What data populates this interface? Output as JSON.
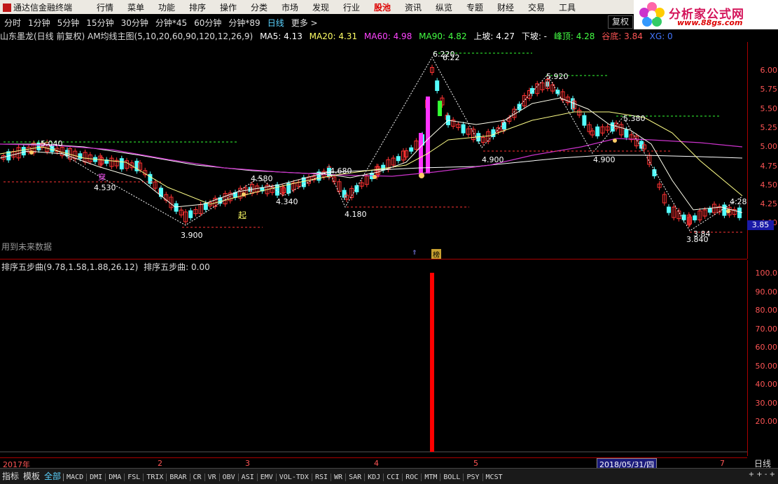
{
  "app": {
    "title": "通达信金融终端"
  },
  "menu": [
    "行情",
    "菜单",
    "功能",
    "排序",
    "操作",
    "分类",
    "市场",
    "发现",
    "行业",
    "股池",
    "资讯",
    "纵览",
    "专题",
    "财经",
    "交易",
    "工具"
  ],
  "menu_active": "股池",
  "brand": {
    "name": "分析家公式网",
    "url": "www.88gs.com"
  },
  "periods": [
    "分时",
    "1分钟",
    "5分钟",
    "15分钟",
    "30分钟",
    "分钟*45",
    "60分钟",
    "分钟*89",
    "日线",
    "更多 >"
  ],
  "period_active": "日线",
  "restore_button": "复权",
  "header": {
    "stock_title": "山东墨龙(日线 前复权) AM均线主图(5,10,20,60,90,120,12,26,9)",
    "ma5": "MA5: 4.13",
    "ma20": "MA20: 4.31",
    "ma60": "MA60: 4.98",
    "ma90": "MA90: 4.82",
    "upslope": "上坡: 4.27",
    "downslope": "下坡: -",
    "peak": "峰顶: 4.28",
    "trough": "谷底: 3.84",
    "xg": "XG: 0"
  },
  "price_axis": [
    "6.00",
    "5.75",
    "5.50",
    "5.25",
    "5.00",
    "4.75",
    "4.50",
    "4.25",
    "4.00"
  ],
  "price_tag": "3.85",
  "annotations": {
    "zigzag_labels": [
      "5.040",
      "4.530",
      "3.900",
      "4.580",
      "4.340",
      "4.680",
      "4.180",
      "6.220",
      "6.22",
      "4.900",
      "5.920",
      "4.900",
      "5.380",
      "4.28",
      "3.84",
      "3.840"
    ],
    "markers": [
      "穿",
      "起",
      "榜"
    ],
    "future_note": "用到未来数据"
  },
  "indicator": {
    "title": "排序五步曲(9.78,1.58,1.88,26.12)",
    "value": "排序五步曲: 0.00",
    "axis": [
      "100.0",
      "90.00",
      "80.00",
      "70.00",
      "60.00",
      "50.00",
      "40.00",
      "30.00",
      "20.00"
    ],
    "spike_value": 100
  },
  "date_axis": {
    "labels": [
      "2017年",
      "2",
      "3",
      "4",
      "5",
      "7"
    ],
    "current": "2018/05/31/四",
    "period": "日线"
  },
  "bottom_tabs": {
    "left": [
      "指标",
      "模板",
      "全部"
    ],
    "indicators": [
      "MACD",
      "DMI",
      "DMA",
      "FSL",
      "TRIX",
      "BRAR",
      "CR",
      "VR",
      "OBV",
      "ASI",
      "EMV",
      "VOL-TDX",
      "RSI",
      "WR",
      "SAR",
      "KDJ",
      "CCI",
      "ROC",
      "MTM",
      "BOLL",
      "PSY",
      "MCST"
    ],
    "controls": "+ + - +"
  },
  "colors": {
    "up": "#ff3333",
    "down": "#54ffff",
    "ma_white": "#ffffff",
    "ma_yellow": "#ffff88",
    "ma_magenta": "#cc33cc",
    "ma_green": "#33ff33",
    "axis": "#aa0000",
    "spike": "#ff0000"
  }
}
